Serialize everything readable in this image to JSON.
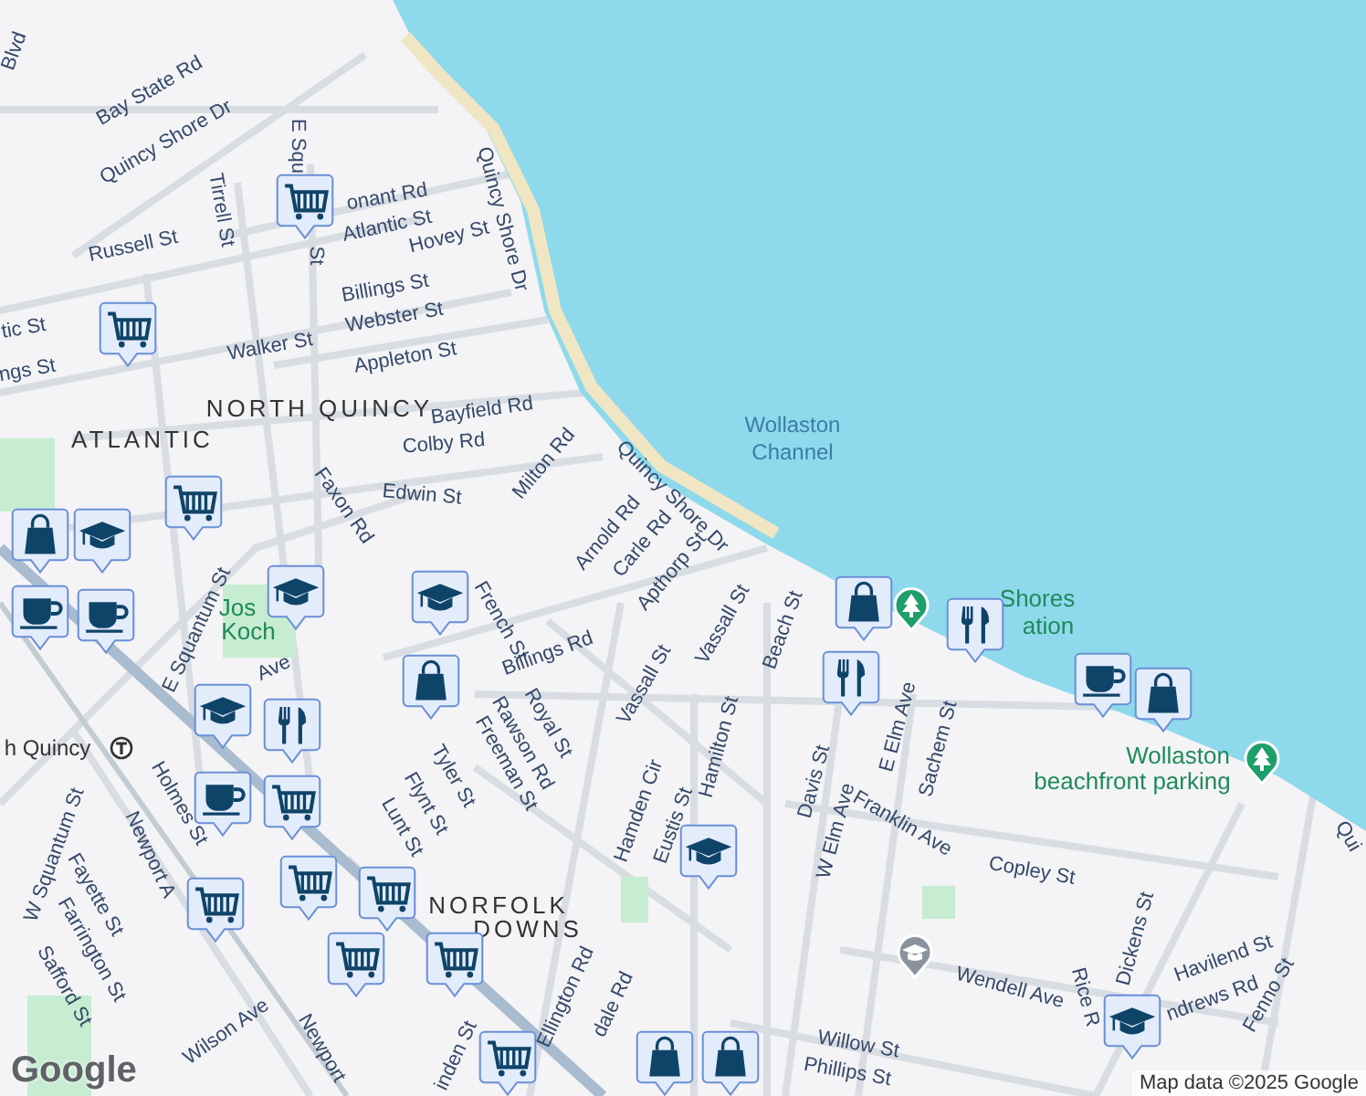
{
  "map": {
    "labels": [
      {
        "text": "Blvd",
        "kind": "street"
      },
      {
        "text": "Bay State Rd",
        "kind": "street"
      },
      {
        "text": "Quincy Shore Dr",
        "kind": "street"
      },
      {
        "text": "E Squ",
        "kind": "street"
      },
      {
        "text": "St",
        "kind": "street"
      },
      {
        "text": "Tirrell St",
        "kind": "street"
      },
      {
        "text": "onant Rd",
        "kind": "street"
      },
      {
        "text": "Atlantic St",
        "kind": "street"
      },
      {
        "text": "Hovey St",
        "kind": "street"
      },
      {
        "text": "Russell St",
        "kind": "street"
      },
      {
        "text": "Quincy Shore Dr",
        "kind": "street"
      },
      {
        "text": "Billings St",
        "kind": "street"
      },
      {
        "text": "tic St",
        "kind": "street"
      },
      {
        "text": "Webster St",
        "kind": "street"
      },
      {
        "text": "ngs St",
        "kind": "street"
      },
      {
        "text": "Walker St",
        "kind": "street"
      },
      {
        "text": "Appleton St",
        "kind": "street"
      },
      {
        "text": "NORTH QUINCY",
        "kind": "district"
      },
      {
        "text": "ATLANTIC",
        "kind": "district"
      },
      {
        "text": "Bayfield Rd",
        "kind": "street"
      },
      {
        "text": "Colby Rd",
        "kind": "street"
      },
      {
        "text": "Milton Rd",
        "kind": "street"
      },
      {
        "text": "Quincy Shore Dr",
        "kind": "street"
      },
      {
        "text": "Edwin St",
        "kind": "street"
      },
      {
        "text": "Faxon Rd",
        "kind": "street"
      },
      {
        "text": "Arnold Rd",
        "kind": "street"
      },
      {
        "text": "Carle Rd",
        "kind": "street"
      },
      {
        "text": "Apthorp St",
        "kind": "street"
      },
      {
        "text": "Wollaston",
        "kind": "water"
      },
      {
        "text": "Channel",
        "kind": "water"
      },
      {
        "text": "Jos",
        "kind": "park"
      },
      {
        "text": "Koch",
        "kind": "park"
      },
      {
        "text": "French St",
        "kind": "street"
      },
      {
        "text": "Billings Rd",
        "kind": "street"
      },
      {
        "text": "E Squantum St",
        "kind": "street"
      },
      {
        "text": "Ave",
        "kind": "street"
      },
      {
        "text": "Royal St",
        "kind": "street"
      },
      {
        "text": "Rawson Rd",
        "kind": "street"
      },
      {
        "text": "Freeman St",
        "kind": "street"
      },
      {
        "text": "Vassall St",
        "kind": "street"
      },
      {
        "text": "Vassall St",
        "kind": "street"
      },
      {
        "text": "Beach St",
        "kind": "street"
      },
      {
        "text": "Hamden Cir",
        "kind": "street"
      },
      {
        "text": "Eustis St",
        "kind": "street"
      },
      {
        "text": "Hamilton St",
        "kind": "street"
      },
      {
        "text": "Tyler St",
        "kind": "street"
      },
      {
        "text": "Flynt St",
        "kind": "street"
      },
      {
        "text": "Lunt St",
        "kind": "street"
      },
      {
        "text": "Holmes St",
        "kind": "street"
      },
      {
        "text": "h Quincy",
        "kind": "station"
      },
      {
        "text": "W Squantum St",
        "kind": "street"
      },
      {
        "text": "Newport A",
        "kind": "street"
      },
      {
        "text": "Fayette St",
        "kind": "street"
      },
      {
        "text": "Farrington St",
        "kind": "street"
      },
      {
        "text": "Safford St",
        "kind": "street"
      },
      {
        "text": "NORFOLK",
        "kind": "district"
      },
      {
        "text": "DOWNS",
        "kind": "district"
      },
      {
        "text": "Davis St",
        "kind": "street"
      },
      {
        "text": "W Elm Ave",
        "kind": "street"
      },
      {
        "text": "E Elm Ave",
        "kind": "street"
      },
      {
        "text": "Sachem St",
        "kind": "street"
      },
      {
        "text": "Franklin Ave",
        "kind": "street"
      },
      {
        "text": "Copley St",
        "kind": "street"
      },
      {
        "text": "Dickens St",
        "kind": "street"
      },
      {
        "text": "Havilend St",
        "kind": "street"
      },
      {
        "text": "ndrews Rd",
        "kind": "street"
      },
      {
        "text": "Fenno St",
        "kind": "street"
      },
      {
        "text": "Wendell Ave",
        "kind": "street"
      },
      {
        "text": "Rice R",
        "kind": "street"
      },
      {
        "text": "Willow St",
        "kind": "street"
      },
      {
        "text": "Phillips St",
        "kind": "street"
      },
      {
        "text": "Wilson Ave",
        "kind": "street"
      },
      {
        "text": "Newport",
        "kind": "street"
      },
      {
        "text": "Ellington Rd",
        "kind": "street"
      },
      {
        "text": "dale Rd",
        "kind": "street"
      },
      {
        "text": "inden St",
        "kind": "street"
      },
      {
        "text": "Qui",
        "kind": "street"
      },
      {
        "text": "Shores",
        "kind": "park"
      },
      {
        "text": "ation",
        "kind": "park"
      },
      {
        "text": "Wollaston",
        "kind": "park"
      },
      {
        "text": "beachfront parking",
        "kind": "park"
      }
    ],
    "markers": [
      {
        "kind": "cart"
      },
      {
        "kind": "cart"
      },
      {
        "kind": "cart"
      },
      {
        "kind": "bag"
      },
      {
        "kind": "cap"
      },
      {
        "kind": "cup"
      },
      {
        "kind": "cup"
      },
      {
        "kind": "cap"
      },
      {
        "kind": "cap"
      },
      {
        "kind": "bag"
      },
      {
        "kind": "cap"
      },
      {
        "kind": "fork"
      },
      {
        "kind": "cup"
      },
      {
        "kind": "cart"
      },
      {
        "kind": "cart"
      },
      {
        "kind": "cart"
      },
      {
        "kind": "cart"
      },
      {
        "kind": "cart"
      },
      {
        "kind": "cart"
      },
      {
        "kind": "cart"
      },
      {
        "kind": "bag"
      },
      {
        "kind": "bag"
      },
      {
        "kind": "bag"
      },
      {
        "kind": "fork"
      },
      {
        "kind": "fork"
      },
      {
        "kind": "cup"
      },
      {
        "kind": "bag"
      },
      {
        "kind": "cap"
      },
      {
        "kind": "cap"
      }
    ],
    "logo": "Google",
    "attribution": "Map data ©2025 Google"
  }
}
